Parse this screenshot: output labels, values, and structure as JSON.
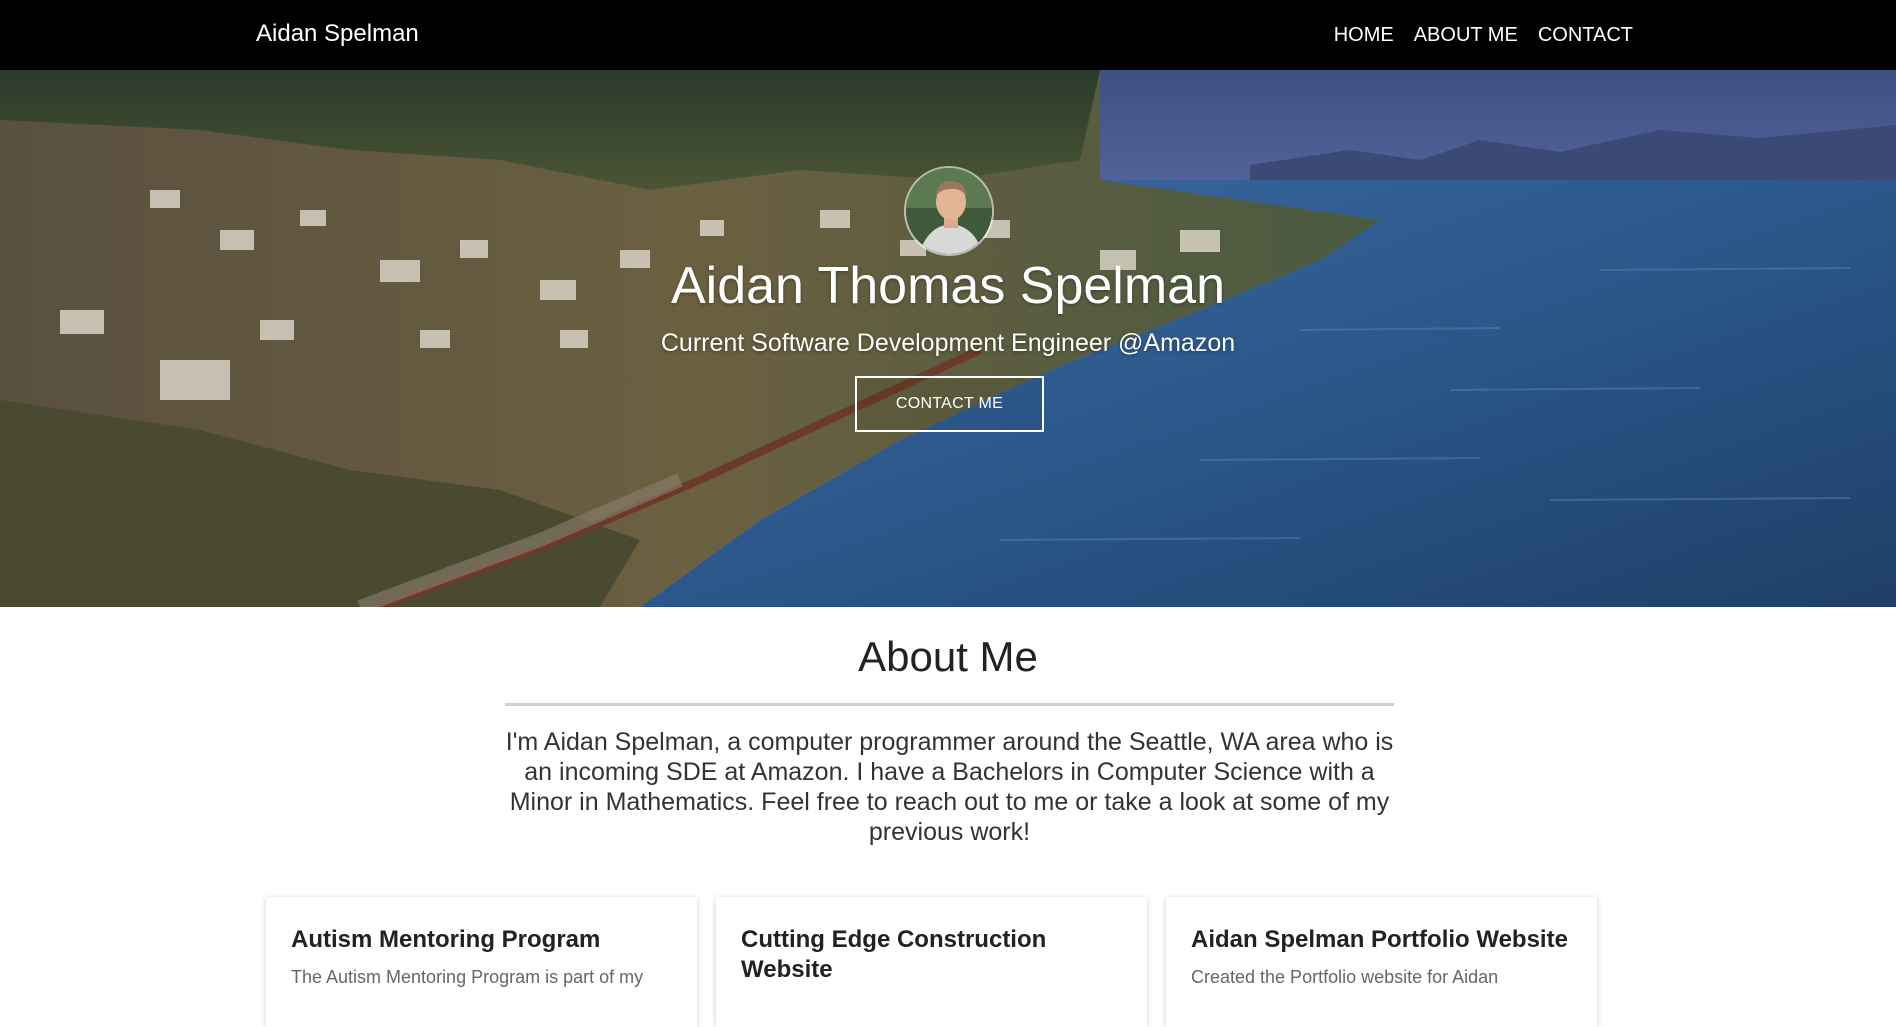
{
  "navbar": {
    "brand": "Aidan Spelman",
    "links": [
      "HOME",
      "ABOUT ME",
      "CONTACT"
    ]
  },
  "hero": {
    "title": "Aidan Thomas Spelman",
    "subtitle": "Current Software Development Engineer @Amazon",
    "cta_label": "CONTACT ME"
  },
  "about": {
    "heading": "About Me",
    "text": "I'm Aidan Spelman, a computer programmer around the Seattle, WA area who is an incoming SDE at Amazon. I have a Bachelors in Computer Science with a Minor in Mathematics. Feel free to reach out to me or take a look at some of my previous work!"
  },
  "projects": [
    {
      "title": "Autism Mentoring Program",
      "desc": "The Autism Mentoring Program is part of my"
    },
    {
      "title": "Cutting Edge Construction Website",
      "desc": ""
    },
    {
      "title": "Aidan Spelman Portfolio Website",
      "desc": "Created the Portfolio website for Aidan"
    }
  ],
  "colors": {
    "navbar_bg": "#000000",
    "text_dark": "#222222",
    "card_desc": "#666666",
    "water_blue": "#2f5f8f"
  }
}
